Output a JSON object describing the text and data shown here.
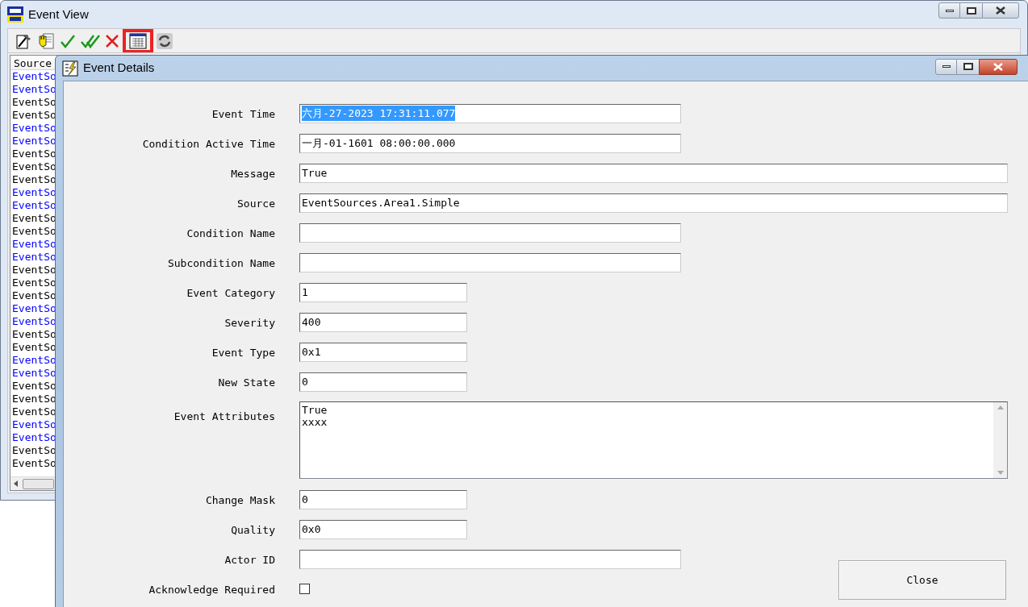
{
  "window": {
    "title": "Event View"
  },
  "toolbar": [
    {
      "kind": "edit",
      "highlighted": false
    },
    {
      "kind": "hand",
      "highlighted": false
    },
    {
      "kind": "check",
      "highlighted": false
    },
    {
      "kind": "double-check",
      "highlighted": false
    },
    {
      "kind": "cross",
      "highlighted": false
    },
    {
      "kind": "table",
      "highlighted": true
    },
    {
      "kind": "refresh",
      "highlighted": false
    }
  ],
  "list": {
    "column": "Source",
    "rows": [
      {
        "text": "EventSo",
        "color": "#0000ff"
      },
      {
        "text": "EventSo",
        "color": "#0000ff"
      },
      {
        "text": "EventSo",
        "color": "#000000"
      },
      {
        "text": "EventSo",
        "color": "#000000"
      },
      {
        "text": "EventSo",
        "color": "#0000ff"
      },
      {
        "text": "EventSo",
        "color": "#0000ff"
      },
      {
        "text": "EventSo",
        "color": "#000000"
      },
      {
        "text": "EventSo",
        "color": "#000000"
      },
      {
        "text": "EventSo",
        "color": "#000000"
      },
      {
        "text": "EventSo",
        "color": "#0000ff"
      },
      {
        "text": "EventSo",
        "color": "#0000ff"
      },
      {
        "text": "EventSo",
        "color": "#000000"
      },
      {
        "text": "EventSo",
        "color": "#000000"
      },
      {
        "text": "EventSo",
        "color": "#0000ff"
      },
      {
        "text": "EventSo",
        "color": "#0000ff"
      },
      {
        "text": "EventSo",
        "color": "#000000"
      },
      {
        "text": "EventSo",
        "color": "#000000"
      },
      {
        "text": "EventSo",
        "color": "#000000"
      },
      {
        "text": "EventSo",
        "color": "#0000ff"
      },
      {
        "text": "EventSo",
        "color": "#0000ff"
      },
      {
        "text": "EventSo",
        "color": "#000000"
      },
      {
        "text": "EventSo",
        "color": "#000000"
      },
      {
        "text": "EventSo",
        "color": "#0000ff"
      },
      {
        "text": "EventSo",
        "color": "#0000ff"
      },
      {
        "text": "EventSo",
        "color": "#000000"
      },
      {
        "text": "EventSo",
        "color": "#000000"
      },
      {
        "text": "EventSo",
        "color": "#000000"
      },
      {
        "text": "EventSo",
        "color": "#0000ff"
      },
      {
        "text": "EventSo",
        "color": "#0000ff"
      },
      {
        "text": "EventSo",
        "color": "#000000"
      },
      {
        "text": "EventSo",
        "color": "#000000"
      }
    ]
  },
  "dialog": {
    "title": "Event Details",
    "fields": [
      {
        "label": "Event Time",
        "kind": "medium",
        "value": "六月-27-2023 17:31:11.077",
        "selected": true
      },
      {
        "label": "Condition Active Time",
        "kind": "medium",
        "value": "一月-01-1601 08:00:00.000",
        "selected": false
      },
      {
        "label": "Message",
        "kind": "wide",
        "value": "True",
        "selected": false
      },
      {
        "label": "Source",
        "kind": "wide",
        "value": "EventSources.Area1.Simple",
        "selected": false
      },
      {
        "label": "Condition Name",
        "kind": "medium",
        "selected": false
      },
      {
        "label": "Subcondition Name",
        "kind": "medium",
        "selected": false
      },
      {
        "label": "Event Category",
        "kind": "short",
        "value": "1",
        "selected": false
      },
      {
        "label": "Severity",
        "kind": "short",
        "value": "400",
        "selected": false
      },
      {
        "label": "Event Type",
        "kind": "short",
        "value": "0x1",
        "selected": false
      },
      {
        "label": "New State",
        "kind": "short",
        "value": "0",
        "selected": false
      },
      {
        "label": "Event Attributes",
        "kind": "multiline",
        "lines": [
          "True",
          "xxxx"
        ]
      }
    ],
    "lower_fields": [
      {
        "label": "Change Mask",
        "kind": "short",
        "value": "0",
        "selected": false
      },
      {
        "label": "Quality",
        "kind": "short",
        "value": "0x0",
        "selected": false
      },
      {
        "label": "Actor ID",
        "kind": "medium",
        "selected": false
      },
      {
        "label": "Acknowledge Required",
        "kind": "checkbox",
        "checked": false
      }
    ],
    "close_button": "Close"
  }
}
